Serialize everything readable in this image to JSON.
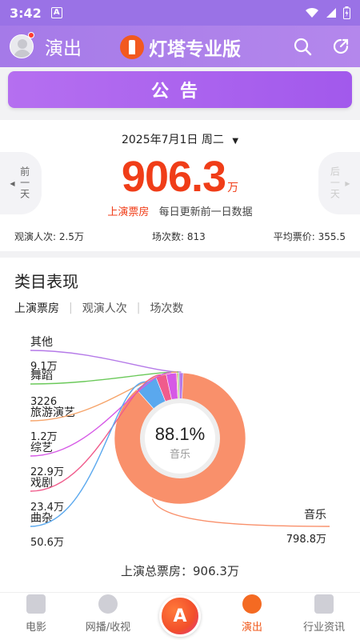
{
  "status_bar": {
    "time": "3:42",
    "a_icon": "A"
  },
  "header": {
    "section_title": "演出",
    "brand_name": "灯塔专业版"
  },
  "announcement": {
    "label": "公告"
  },
  "summary": {
    "date": "2025年7月1日 周二",
    "prev_label": "前一天",
    "next_label": "后一天",
    "box_office": "906.3",
    "unit": "万",
    "box_office_label": "上演票房",
    "update_note": "每日更新前一日数据",
    "attendance": "观演人次: 2.5万",
    "sessions": "场次数: 813",
    "avg_price": "平均票价: 355.5"
  },
  "category": {
    "title": "类目表现",
    "tabs": [
      "上演票房",
      "观演人次",
      "场次数"
    ],
    "total": "上演总票房：906.3万"
  },
  "chart_data": {
    "type": "pie",
    "center_percent": "88.1%",
    "center_label": "音乐",
    "slices": [
      {
        "name": "音乐",
        "value_label": "798.8万",
        "value": 798.8,
        "color": "#f9906b"
      },
      {
        "name": "曲杂",
        "value_label": "50.6万",
        "value": 50.6,
        "color": "#5aa8ee"
      },
      {
        "name": "戏剧",
        "value_label": "23.4万",
        "value": 23.4,
        "color": "#f05c8c"
      },
      {
        "name": "综艺",
        "value_label": "22.9万",
        "value": 22.9,
        "color": "#d659e6"
      },
      {
        "name": "旅游演艺",
        "value_label": "1.2万",
        "value": 1.2,
        "color": "#f6a46a"
      },
      {
        "name": "舞蹈",
        "value_label": "3226",
        "value": 0.32,
        "color": "#6bc95a"
      },
      {
        "name": "其他",
        "value_label": "9.1万",
        "value": 9.1,
        "color": "#b57ae8"
      }
    ]
  },
  "tabbar": {
    "items": [
      "电影",
      "网播/收视",
      "",
      "演出",
      "行业资讯"
    ],
    "ai_label": "A"
  },
  "colors": {
    "accent": "#a57ae8",
    "highlight": "#f03d18"
  }
}
